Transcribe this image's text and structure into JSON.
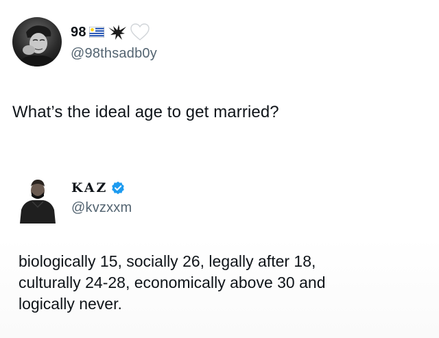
{
  "post_original": {
    "author": {
      "display_name": "98",
      "handle": "@98thsadb0y",
      "name_icons": [
        "uruguay-flag-icon",
        "eagle-icon",
        "white-heart-icon"
      ]
    },
    "text": "What’s the ideal age to get married?"
  },
  "post_reply": {
    "author": {
      "display_name": "KAZ",
      "handle": "@kvzxxm",
      "verified": true,
      "verified_color": "#1d9bf0"
    },
    "text_lines": [
      "biologically 15, socially 26, legally after 18,",
      "culturally 24-28, economically above 30 and",
      "logically never."
    ]
  },
  "colors": {
    "primary_text": "#0f1419",
    "secondary_text": "#536471",
    "background": "#ffffff"
  }
}
